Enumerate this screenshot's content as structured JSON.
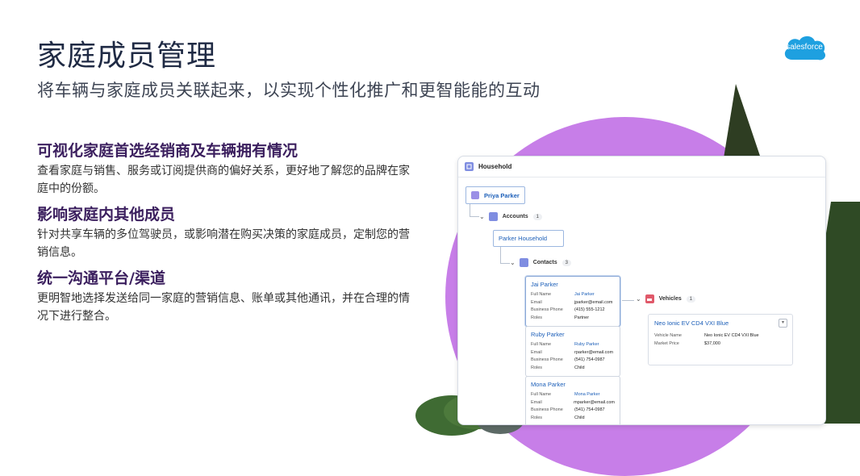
{
  "header": {
    "title": "家庭成员管理",
    "subtitle": "将车辆与家庭成员关联起来，以实现个性化推广和更智能能的互动",
    "logo_text": "salesforce"
  },
  "sections": [
    {
      "heading": "可视化家庭首选经销商及车辆拥有情况",
      "body": "查看家庭与销售、服务或订阅提供商的偏好关系，更好地了解您的品牌在家庭中的份额。"
    },
    {
      "heading": "影响家庭内其他成员",
      "body": "针对共享车辆的多位驾驶员，或影响潜在购买决策的家庭成员，定制您的营销信息。"
    },
    {
      "heading": "统一沟通平台/渠道",
      "body": "更明智地选择发送给同一家庭的营销信息、账单或其他通讯，并在合理的情况下进行整合。"
    }
  ],
  "panel": {
    "title": "Household",
    "root": "Priya Parker",
    "accounts": {
      "label": "Accounts",
      "count": "1",
      "item": "Parker Household"
    },
    "contacts": {
      "label": "Contacts",
      "count": "3"
    },
    "vehicles": {
      "label": "Vehicles",
      "count": "1"
    },
    "contact_cards": [
      {
        "name": "Jai Parker",
        "fields": [
          {
            "k": "Full Name",
            "v": "Jai Parker"
          },
          {
            "k": "Email",
            "v": "jparker@email.com"
          },
          {
            "k": "Business Phone",
            "v": "(415) 555-1212"
          },
          {
            "k": "Roles",
            "v": "Partner"
          }
        ]
      },
      {
        "name": "Ruby Parker",
        "fields": [
          {
            "k": "Full Name",
            "v": "Ruby Parker"
          },
          {
            "k": "Email",
            "v": "rparker@email.com"
          },
          {
            "k": "Business Phone",
            "v": "(541) 754-0987"
          },
          {
            "k": "Roles",
            "v": "Child"
          }
        ]
      },
      {
        "name": "Mona Parker",
        "fields": [
          {
            "k": "Full Name",
            "v": "Mona Parker"
          },
          {
            "k": "Email",
            "v": "mparker@email.com"
          },
          {
            "k": "Business Phone",
            "v": "(541) 754-0987"
          },
          {
            "k": "Roles",
            "v": "Child"
          }
        ]
      }
    ],
    "vehicle_card": {
      "title": "Neo Ionic EV CD4 VXI Blue",
      "fields": [
        {
          "k": "Vehicle Name",
          "v": "Neo Ionic EV CD4 VXI Blue"
        },
        {
          "k": "Market Price",
          "v": "$37,000"
        }
      ]
    }
  },
  "colors": {
    "accent_purple": "#c77ee8",
    "heading": "#3b1f5e",
    "title": "#1f2a44",
    "link": "#1b5eb8",
    "logo_blue": "#1ea0e0",
    "tree_green": "#2e3d22"
  }
}
